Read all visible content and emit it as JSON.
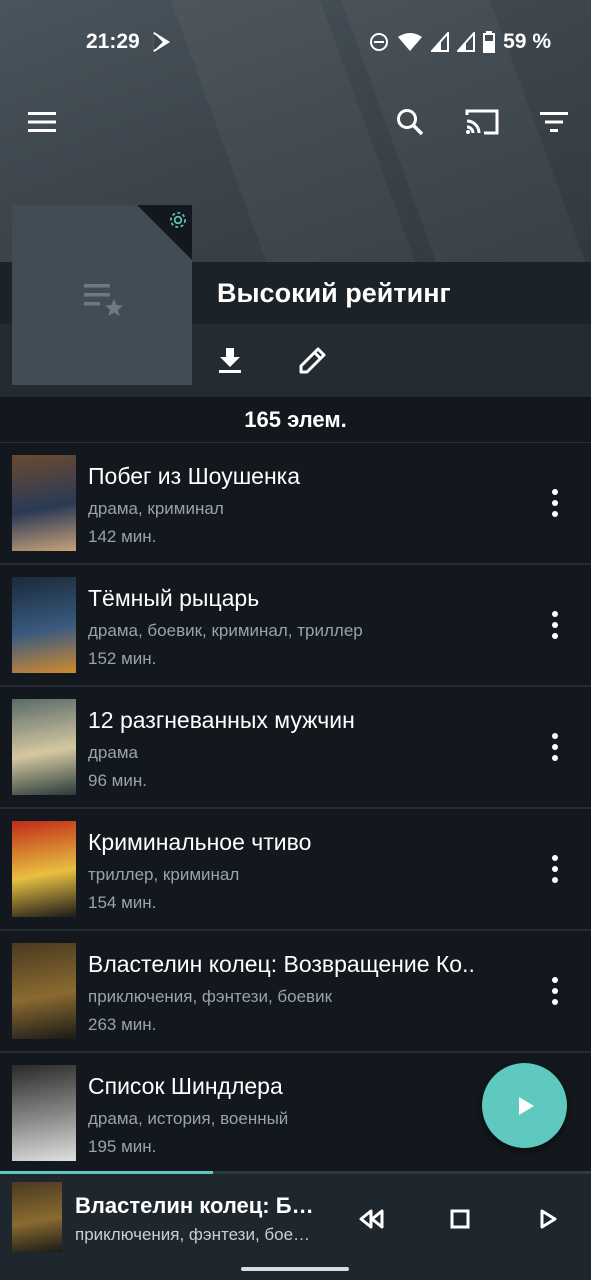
{
  "status_bar": {
    "time": "21:29",
    "battery": "59 %",
    "icons": [
      "play-store-icon",
      "dnd-icon",
      "wifi-icon",
      "signal-icon",
      "signal-icon",
      "battery-icon"
    ]
  },
  "toolbar": {
    "icons": [
      "menu-icon",
      "search-icon",
      "cast-icon",
      "filter-icon"
    ]
  },
  "playlist": {
    "title": "Высокий рейтинг",
    "count": "165 элем.",
    "cover_icon": "playlist-star-icon",
    "actions": [
      "download-icon",
      "edit-icon"
    ]
  },
  "items": [
    {
      "title": "Побег из Шоушенка",
      "genres": "драма, криминал",
      "duration": "142 мин.",
      "poster_colors": [
        "#6b4a30",
        "#2a3a55",
        "#c9a27a"
      ]
    },
    {
      "title": "Тёмный рыцарь",
      "genres": "драма, боевик, криминал, триллер",
      "duration": "152 мин.",
      "poster_colors": [
        "#1a2a3a",
        "#3a5a80",
        "#d08a30"
      ]
    },
    {
      "title": "12 разгневанных мужчин",
      "genres": "драма",
      "duration": "96 мин.",
      "poster_colors": [
        "#5a6a6a",
        "#d4c8a0",
        "#2a3a3a"
      ]
    },
    {
      "title": "Криминальное чтиво",
      "genres": "триллер, криминал",
      "duration": "154 мин.",
      "poster_colors": [
        "#c02a1a",
        "#e8c040",
        "#1a1a1a"
      ]
    },
    {
      "title": "Властелин колец: Возвращение Ко..",
      "genres": "приключения, фэнтези, боевик",
      "duration": "263 мин.",
      "poster_colors": [
        "#4a3a20",
        "#8a6a30",
        "#1a1a18"
      ]
    },
    {
      "title": "Список Шиндлера",
      "genres": "драма, история, военный",
      "duration": "195 мин.",
      "poster_colors": [
        "#2a2a2a",
        "#8a8a8a",
        "#e0e0e0"
      ]
    }
  ],
  "player": {
    "title": "Властелин колец: Бр…",
    "subtitle": "приключения, фэнтези, бое…",
    "progress": 0.36,
    "controls": [
      "rewind-icon",
      "stop-icon",
      "play-icon"
    ]
  },
  "colors": {
    "accent": "#5fc9c0",
    "background": "#12181d"
  }
}
